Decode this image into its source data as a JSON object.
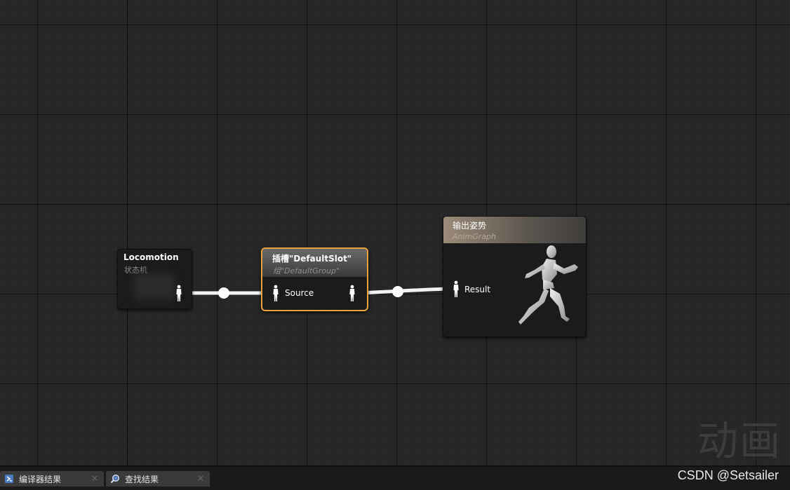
{
  "graph": {
    "nodes": {
      "locomotion": {
        "title": "Locomotion",
        "subtitle": "状态机"
      },
      "slot": {
        "title": "插槽\"DefaultSlot\"",
        "subtitle": "组\"DefaultGroup\"",
        "pin_label": "Source"
      },
      "output": {
        "title": "输出姿势",
        "subtitle": "AnimGraph",
        "pin_label": "Result"
      }
    },
    "watermark": "动画"
  },
  "bottom_bar": {
    "tabs": [
      {
        "label": "编译器结果",
        "close": "×"
      },
      {
        "label": "查找结果",
        "close": "×"
      }
    ],
    "credit": "CSDN @Setsailer"
  }
}
